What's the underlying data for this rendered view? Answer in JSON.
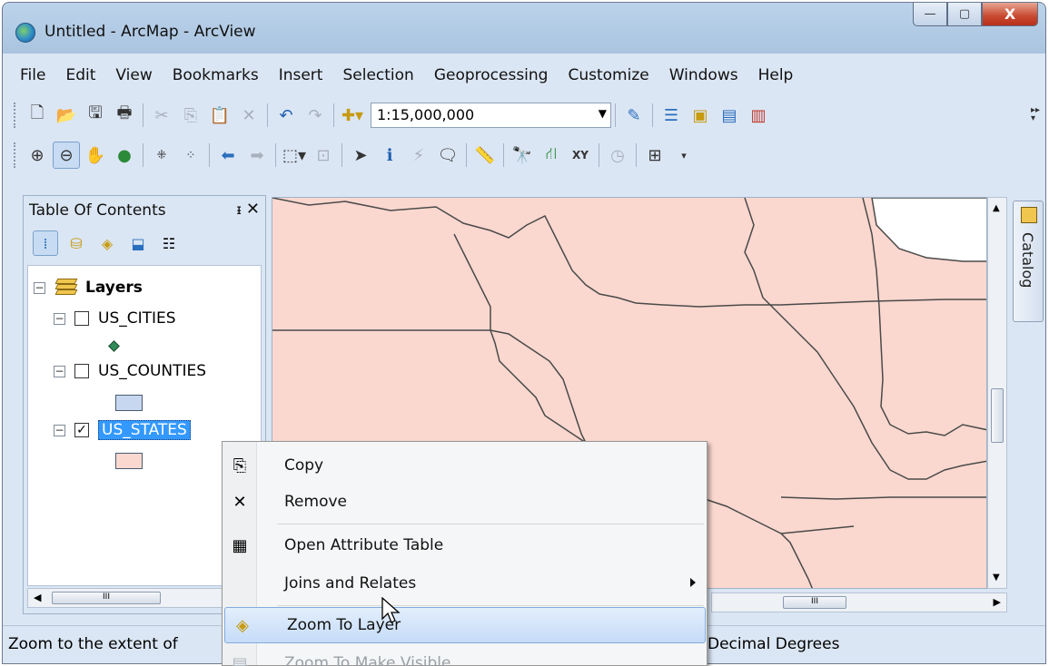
{
  "window": {
    "title": "Untitled - ArcMap - ArcView",
    "minimize": "—",
    "maximize": "▢",
    "close": "X"
  },
  "menubar": {
    "items": [
      "File",
      "Edit",
      "View",
      "Bookmarks",
      "Insert",
      "Selection",
      "Geoprocessing",
      "Customize",
      "Windows",
      "Help"
    ]
  },
  "toolbar": {
    "scale": "1:15,000,000"
  },
  "toc": {
    "title": "Table Of Contents",
    "pin": "ᵻ",
    "close": "✕",
    "root": "Layers",
    "layers": [
      {
        "name": "US_CITIES",
        "checked": false
      },
      {
        "name": "US_COUNTIES",
        "checked": false
      },
      {
        "name": "US_STATES",
        "checked": true,
        "selected": true
      }
    ],
    "scroll_mark": "III"
  },
  "catalog_tab": {
    "label": "Catalog"
  },
  "statusbar": {
    "hint": "Zoom to the extent of",
    "units": "Decimal Degrees"
  },
  "map": {
    "fill_color": "#fad8cf",
    "scroll_mark": "III"
  },
  "context_menu": {
    "items": [
      {
        "label": "Copy",
        "icon": "copy-icon"
      },
      {
        "label": "Remove",
        "icon": "remove-icon"
      },
      {
        "label": "Open Attribute Table",
        "icon": "table-icon"
      },
      {
        "label": "Joins and Relates",
        "icon": "",
        "submenu": true
      },
      {
        "label": "Zoom To Layer",
        "icon": "zoom-to-layer-icon",
        "highlighted": true
      },
      {
        "label": "Zoom To Make Visible",
        "icon": "zoom-visible-icon",
        "disabled": true
      }
    ]
  }
}
